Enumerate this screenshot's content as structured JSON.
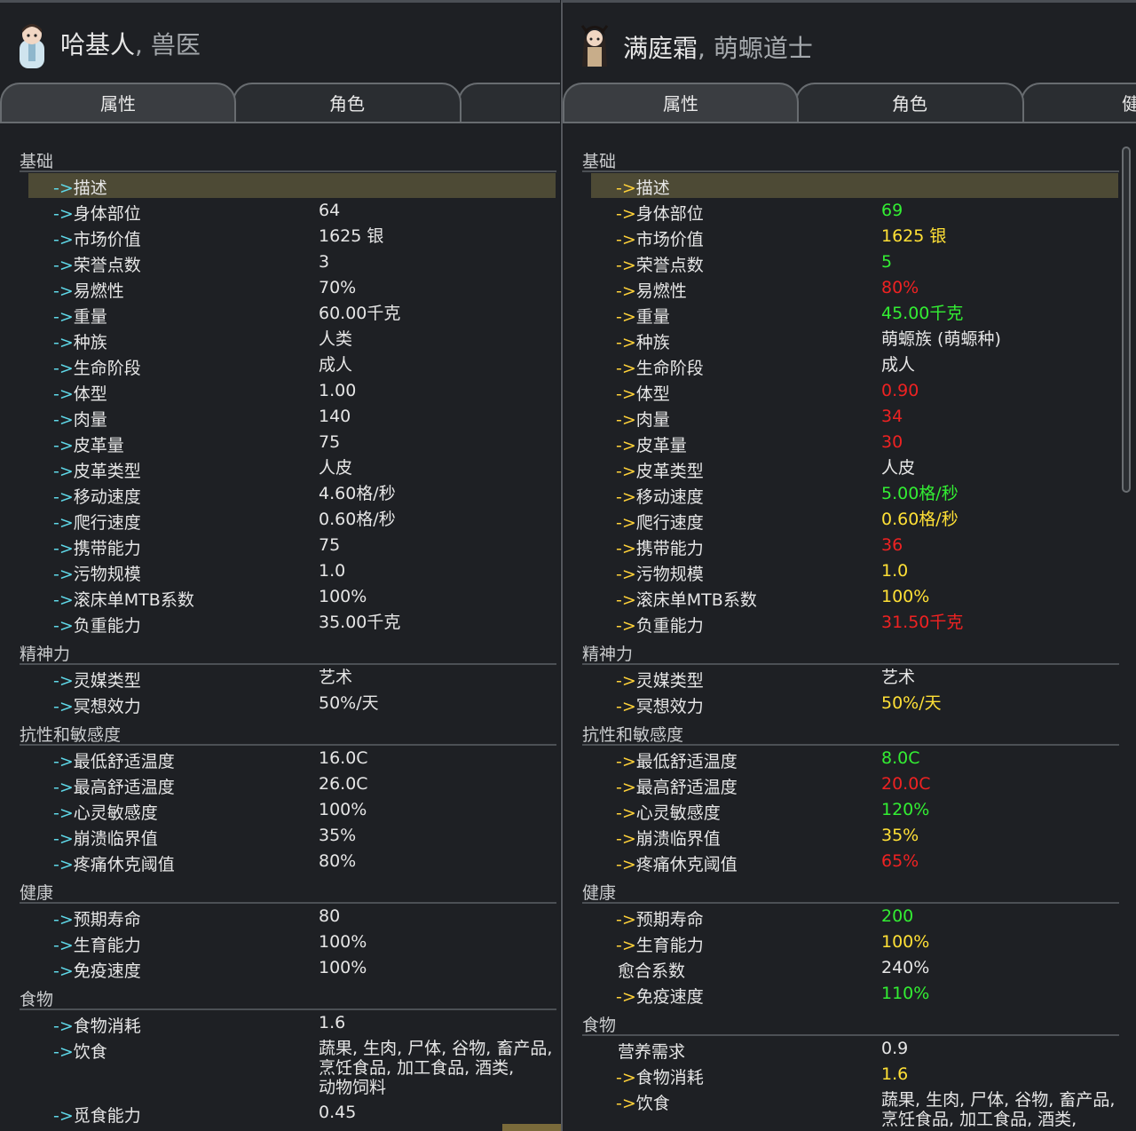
{
  "left": {
    "name": "哈基人",
    "role": "兽医",
    "tabs": [
      "属性",
      "角色",
      ""
    ],
    "sections": [
      {
        "title": "基础",
        "rows": [
          {
            "label": "描述",
            "value": "",
            "highlight": true
          },
          {
            "label": "身体部位",
            "value": "64"
          },
          {
            "label": "市场价值",
            "value": "1625 银"
          },
          {
            "label": "荣誉点数",
            "value": "3"
          },
          {
            "label": "易燃性",
            "value": "70%"
          },
          {
            "label": "重量",
            "value": "60.00千克"
          },
          {
            "label": "种族",
            "value": "人类"
          },
          {
            "label": "生命阶段",
            "value": "成人"
          },
          {
            "label": "体型",
            "value": "1.00"
          },
          {
            "label": "肉量",
            "value": "140"
          },
          {
            "label": "皮革量",
            "value": "75"
          },
          {
            "label": "皮革类型",
            "value": "人皮"
          },
          {
            "label": "移动速度",
            "value": "4.60格/秒"
          },
          {
            "label": "爬行速度",
            "value": "0.60格/秒"
          },
          {
            "label": "携带能力",
            "value": "75"
          },
          {
            "label": "污物规模",
            "value": "1.0"
          },
          {
            "label": "滚床单MTB系数",
            "value": "100%"
          },
          {
            "label": "负重能力",
            "value": "35.00千克"
          }
        ]
      },
      {
        "title": "精神力",
        "rows": [
          {
            "label": "灵媒类型",
            "value": "艺术"
          },
          {
            "label": "冥想效力",
            "value": "50%/天"
          }
        ]
      },
      {
        "title": "抗性和敏感度",
        "rows": [
          {
            "label": "最低舒适温度",
            "value": "16.0C"
          },
          {
            "label": "最高舒适温度",
            "value": "26.0C"
          },
          {
            "label": "心灵敏感度",
            "value": "100%"
          },
          {
            "label": "崩溃临界值",
            "value": "35%"
          },
          {
            "label": "疼痛休克阈值",
            "value": "80%"
          }
        ]
      },
      {
        "title": "健康",
        "rows": [
          {
            "label": "预期寿命",
            "value": "80"
          },
          {
            "label": "生育能力",
            "value": "100%"
          },
          {
            "label": "免疫速度",
            "value": "100%"
          }
        ]
      },
      {
        "title": "食物",
        "rows": [
          {
            "label": "食物消耗",
            "value": "1.6"
          },
          {
            "label": "饮食",
            "value": "蔬果, 生肉, 尸体, 谷物, 畜产品,\n烹饪食品, 加工食品, 酒类,\n动物饲料",
            "lines": 3
          },
          {
            "label": "觅食能力",
            "value": "0.45"
          }
        ]
      }
    ]
  },
  "right": {
    "name": "满庭霜",
    "role": "萌螈道士",
    "tabs": [
      "属性",
      "角色",
      "健"
    ],
    "sections": [
      {
        "title": "基础",
        "rows": [
          {
            "label": "描述",
            "value": "",
            "highlight": true
          },
          {
            "label": "身体部位",
            "value": "69",
            "color": "green"
          },
          {
            "label": "市场价值",
            "value": "1625 银",
            "color": "yellow"
          },
          {
            "label": "荣誉点数",
            "value": "5",
            "color": "green"
          },
          {
            "label": "易燃性",
            "value": "80%",
            "color": "red"
          },
          {
            "label": "重量",
            "value": "45.00千克",
            "color": "green"
          },
          {
            "label": "种族",
            "value": "萌螈族 (萌螈种)",
            "color": "white"
          },
          {
            "label": "生命阶段",
            "value": "成人",
            "color": "white"
          },
          {
            "label": "体型",
            "value": "0.90",
            "color": "red"
          },
          {
            "label": "肉量",
            "value": "34",
            "color": "red"
          },
          {
            "label": "皮革量",
            "value": "30",
            "color": "red"
          },
          {
            "label": "皮革类型",
            "value": "人皮",
            "color": "white"
          },
          {
            "label": "移动速度",
            "value": "5.00格/秒",
            "color": "green"
          },
          {
            "label": "爬行速度",
            "value": "0.60格/秒",
            "color": "yellow"
          },
          {
            "label": "携带能力",
            "value": "36",
            "color": "red"
          },
          {
            "label": "污物规模",
            "value": "1.0",
            "color": "yellow"
          },
          {
            "label": "滚床单MTB系数",
            "value": "100%",
            "color": "yellow"
          },
          {
            "label": "负重能力",
            "value": "31.50千克",
            "color": "red"
          }
        ]
      },
      {
        "title": "精神力",
        "rows": [
          {
            "label": "灵媒类型",
            "value": "艺术",
            "color": "white"
          },
          {
            "label": "冥想效力",
            "value": "50%/天",
            "color": "yellow"
          }
        ]
      },
      {
        "title": "抗性和敏感度",
        "rows": [
          {
            "label": "最低舒适温度",
            "value": "8.0C",
            "color": "green"
          },
          {
            "label": "最高舒适温度",
            "value": "20.0C",
            "color": "red"
          },
          {
            "label": "心灵敏感度",
            "value": "120%",
            "color": "green"
          },
          {
            "label": "崩溃临界值",
            "value": "35%",
            "color": "yellow"
          },
          {
            "label": "疼痛休克阈值",
            "value": "65%",
            "color": "red"
          }
        ]
      },
      {
        "title": "健康",
        "rows": [
          {
            "label": "预期寿命",
            "value": "200",
            "color": "green"
          },
          {
            "label": "生育能力",
            "value": "100%",
            "color": "yellow"
          },
          {
            "label": "愈合系数",
            "value": "240%",
            "color": "white",
            "noarrow": true
          },
          {
            "label": "免疫速度",
            "value": "110%",
            "color": "green"
          }
        ]
      },
      {
        "title": "食物",
        "rows": [
          {
            "label": "营养需求",
            "value": "0.9",
            "color": "white",
            "noarrow": true
          },
          {
            "label": "食物消耗",
            "value": "1.6",
            "color": "yellow"
          },
          {
            "label": "饮食",
            "value": "蔬果, 生肉, 尸体, 谷物, 畜产品,\n烹饪食品, 加工食品, 酒类,",
            "color": "white",
            "lines": 2
          }
        ]
      }
    ]
  },
  "arrow": "->",
  "colors": {
    "green": "#33ee33",
    "yellow": "#ffe036",
    "red": "#ee2222",
    "cyan_arrow": "#5fd8e8",
    "yellow_arrow": "#ffd23a"
  }
}
